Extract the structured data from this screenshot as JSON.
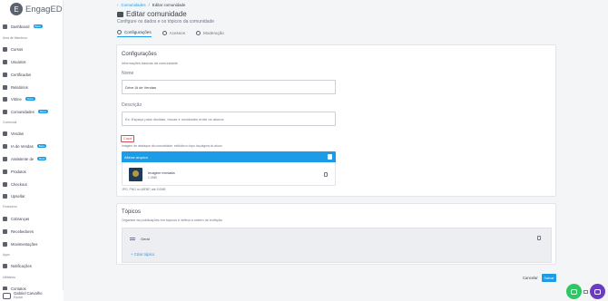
{
  "brand": {
    "logo_text": "EngagED",
    "logo_mark": "E"
  },
  "sidebar": {
    "items": [
      {
        "label": "Dashboard",
        "badge": "Beta",
        "icon": "dashboard-icon"
      },
      {
        "section": "Área de Membros"
      },
      {
        "label": "Cursos",
        "icon": "book-icon"
      },
      {
        "label": "Usuários",
        "icon": "users-icon"
      },
      {
        "label": "Certificados",
        "icon": "certificate-icon"
      },
      {
        "label": "Relatórios",
        "icon": "report-icon"
      },
      {
        "label": "Vitrine",
        "badge": "Novo",
        "icon": "store-icon"
      },
      {
        "label": "Comunidades",
        "badge": "Novo",
        "icon": "community-icon"
      },
      {
        "section": "Comercial"
      },
      {
        "label": "Vendas",
        "icon": "dollar-icon"
      },
      {
        "label": "IA de Vendas",
        "badge": "Beta",
        "icon": "ai-icon"
      },
      {
        "label": "Assistente de",
        "badge": "Beta",
        "icon": "assistant-icon"
      },
      {
        "label": "Produtos",
        "icon": "box-icon"
      },
      {
        "label": "Checkout",
        "icon": "cart-icon"
      },
      {
        "label": "Upsellar",
        "icon": "upsell-icon"
      },
      {
        "section": "Financeiro"
      },
      {
        "label": "Cobranças",
        "icon": "billing-icon"
      },
      {
        "label": "Recebedores",
        "icon": "receivers-icon"
      },
      {
        "label": "Movimentações",
        "icon": "movements-icon"
      },
      {
        "section": "Apps"
      },
      {
        "label": "Notificações",
        "icon": "bell-icon"
      },
      {
        "section": "Utilitários"
      },
      {
        "label": "Contatos",
        "icon": "contacts-icon"
      }
    ]
  },
  "user": {
    "name": "Gabriel Carvalho",
    "role": "Equipe"
  },
  "breadcrumb": {
    "back_glyph": "‹",
    "link": "Comunidades",
    "separator": "/",
    "current": "Editar comunidade"
  },
  "header": {
    "title": "Editar comunidade",
    "subtitle": "Configure os dados e os tópicos da comunidade"
  },
  "tabs": [
    {
      "label": "Configurações",
      "icon": "gear-icon",
      "active": true
    },
    {
      "label": "Acessos",
      "icon": "lock-icon",
      "active": false
    },
    {
      "label": "Moderação",
      "icon": "shield-icon",
      "active": false
    }
  ],
  "settings": {
    "title": "Configurações",
    "subtitle": "Informações básicas da comunidade",
    "name_label": "Nome",
    "name_value": "Drive IA de Vendas",
    "description_label": "Descrição",
    "description_placeholder": "Ex: Espaço para dúvidas, trocas e novidades entre os alunos",
    "cover_label": "Capa",
    "cover_help": "Imagem de destaque da comunidade, exibida no topo da página do aluno",
    "upload_title": "Alterar arquivo",
    "file_name": "Imagem enviada",
    "file_size": "1.0MB",
    "formats_help": "JPG, PNG ou WEBP, até 5.0MB"
  },
  "topics": {
    "title": "Tópicos",
    "subtitle": "Organize as publicações em tópicos e defina a ordem de exibição",
    "items": [
      {
        "label": "Geral"
      }
    ],
    "add_label": "+ Criar tópico"
  },
  "actions": {
    "cancel": "Cancelar",
    "save": "Salvar"
  },
  "colors": {
    "accent": "#1c9be6",
    "danger": "#e04a4a",
    "whatsapp": "#2fc763",
    "chat": "#6a3dbd"
  }
}
